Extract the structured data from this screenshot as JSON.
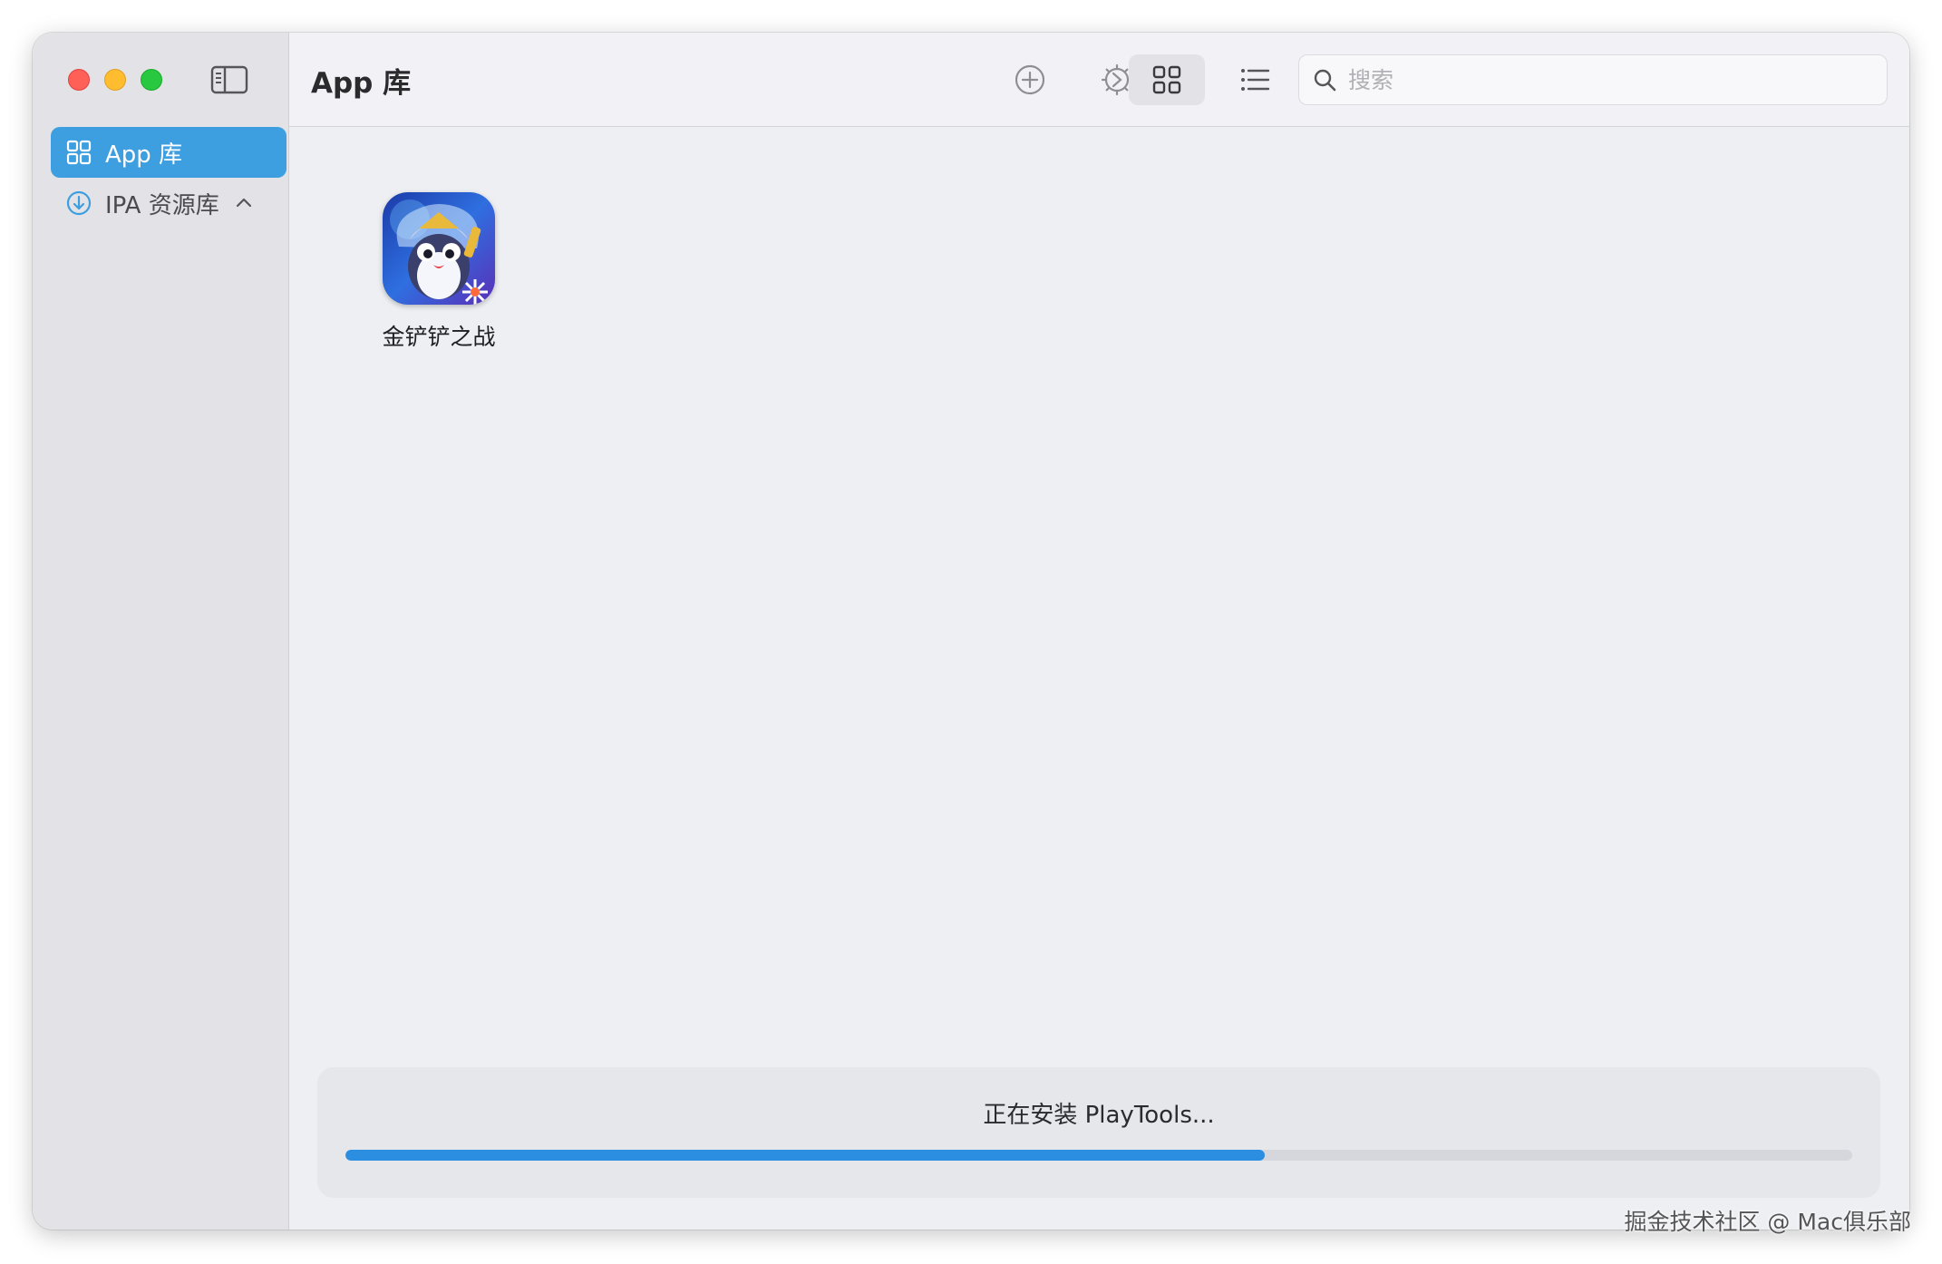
{
  "window": {
    "title": "App 库"
  },
  "sidebar": {
    "items": [
      {
        "label": "App 库",
        "icon": "grid-icon",
        "active": true
      },
      {
        "label": "IPA 资源库",
        "icon": "download-circle-icon",
        "expanded": true
      }
    ]
  },
  "toolbar": {
    "buttons": [
      "add-icon",
      "settings-icon",
      "grid-view-icon",
      "list-view-icon"
    ],
    "search_placeholder": "搜索"
  },
  "apps": [
    {
      "name": "金铲铲之战"
    }
  ],
  "progress": {
    "text": "正在安装 PlayTools...",
    "percent": 61
  },
  "watermark": "掘金技术社区 @ Mac俱乐部",
  "colors": {
    "accent": "#3d9ee0",
    "progress": "#2c8ee0",
    "traffic_red": "#fe5f57",
    "traffic_yellow": "#febc2e",
    "traffic_green": "#28c840"
  }
}
